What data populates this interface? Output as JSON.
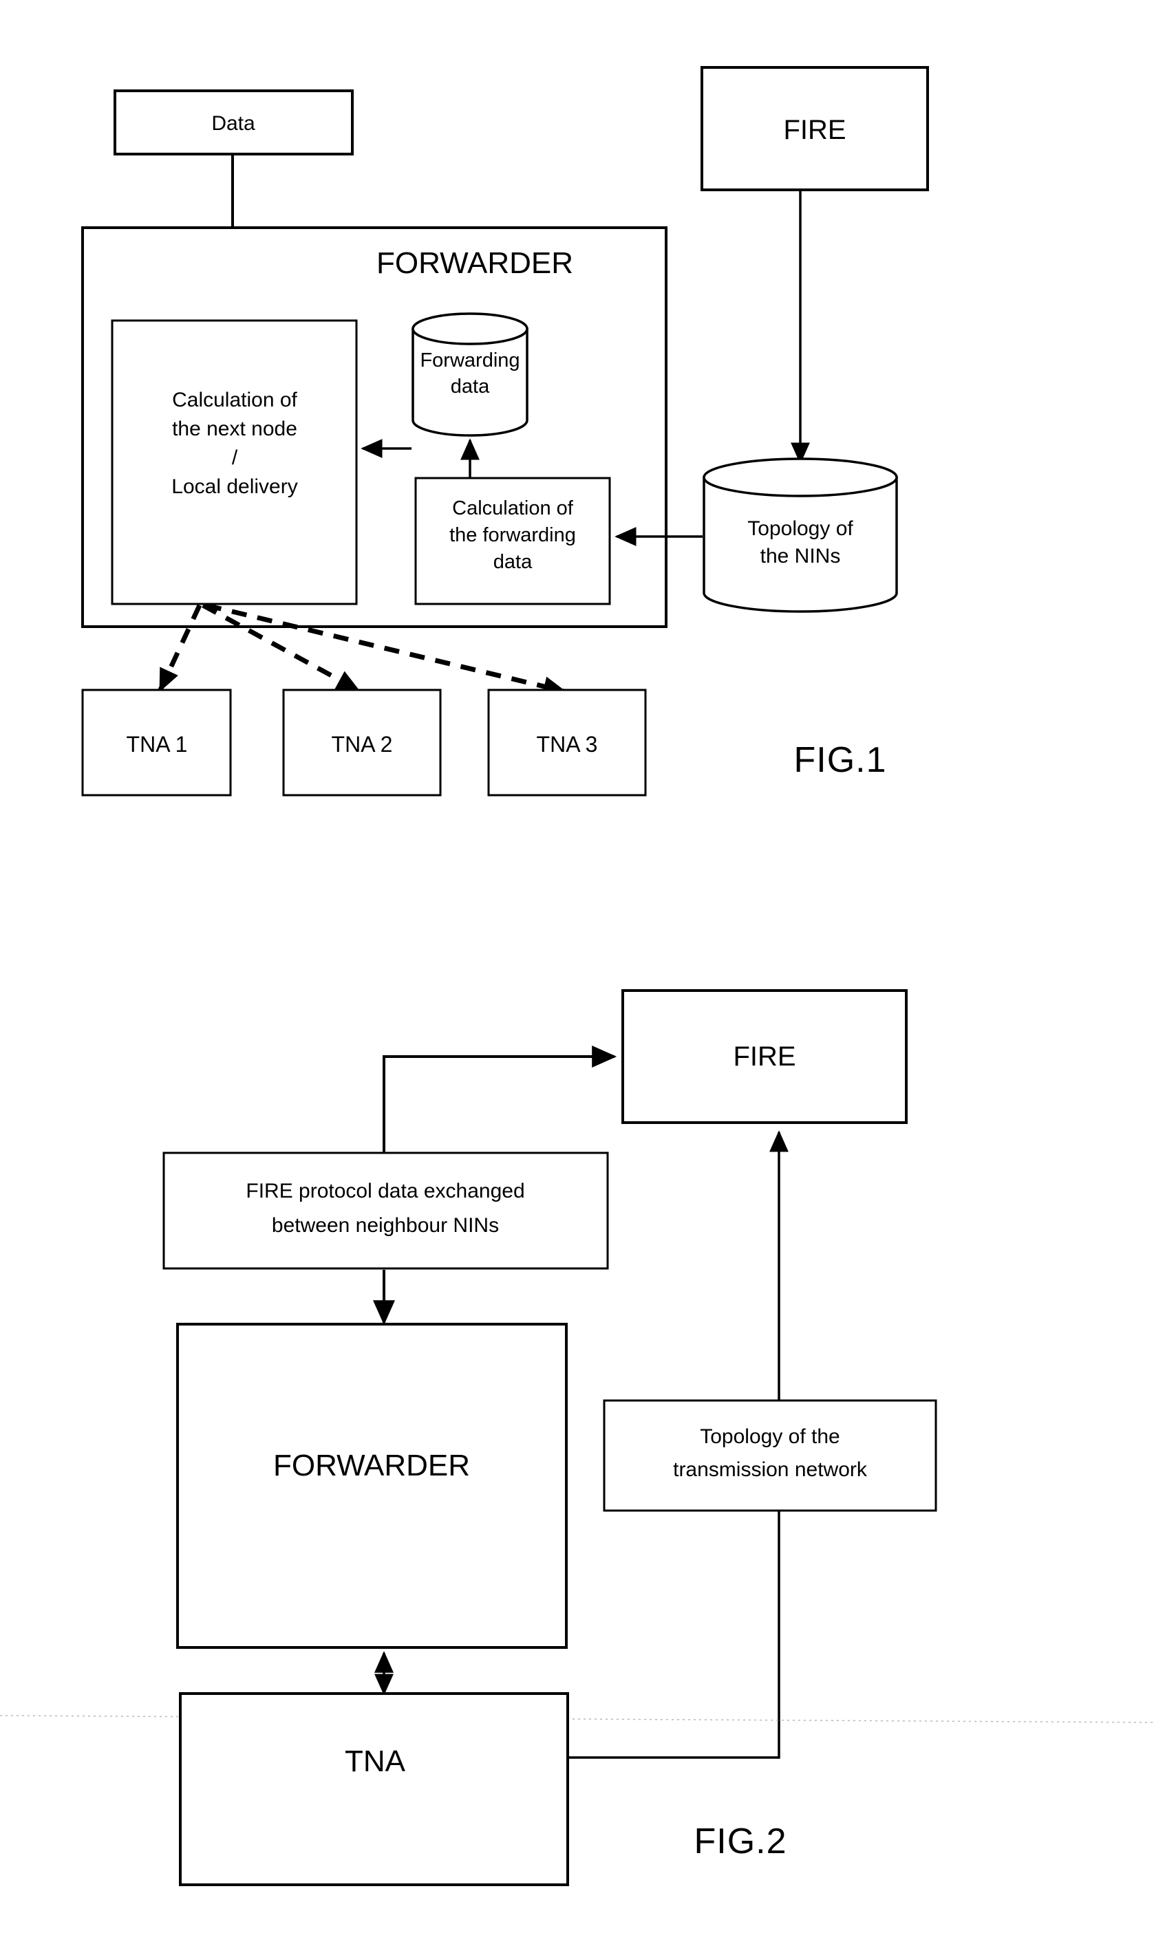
{
  "sheet": {
    "background": "#ffffff",
    "ink": "#000000"
  },
  "figures": [
    {
      "id": "fig1",
      "caption": "FIG.1",
      "nodes": {
        "data_box": "Data",
        "fire_box": "FIRE",
        "forwarder_title": "FORWARDER",
        "calc_next_node_line1": "Calculation of",
        "calc_next_node_line2": "the next node",
        "calc_next_node_line3": "/",
        "calc_next_node_line4": "Local delivery",
        "forwarding_data_line1": "Forwarding",
        "forwarding_data_line2": "data",
        "calc_fwd_line1": "Calculation of",
        "calc_fwd_line2": "the forwarding",
        "calc_fwd_line3": "data",
        "topology_line1": "Topology of",
        "topology_line2": "the NINs",
        "tna1": "TNA 1",
        "tna2": "TNA 2",
        "tna3": "TNA 3"
      }
    },
    {
      "id": "fig2",
      "caption": "FIG.2",
      "nodes": {
        "fire_box": "FIRE",
        "fire_protocol_line1": "FIRE protocol data exchanged",
        "fire_protocol_line2": "between neighbour NINs",
        "forwarder_box": "FORWARDER",
        "topology_line1": "Topology of the",
        "topology_line2": "transmission network",
        "tna_box": "TNA"
      }
    }
  ]
}
